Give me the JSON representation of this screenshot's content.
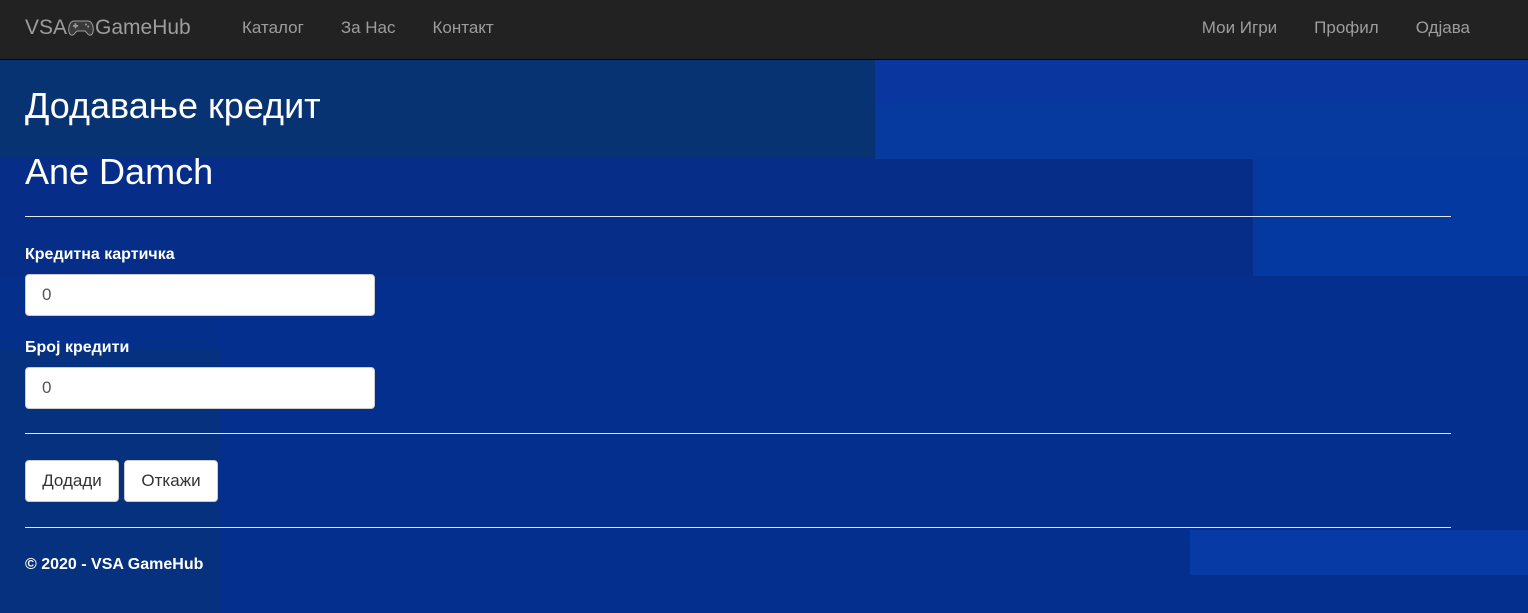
{
  "navbar": {
    "brand_prefix": "VSA",
    "brand_suffix": "GameHub",
    "brand_icon": "gamepad-icon",
    "left_links": [
      "Каталог",
      "За Нас",
      "Контакт"
    ],
    "right_links": [
      "Мои Игри",
      "Профил",
      "Одјава"
    ]
  },
  "page": {
    "title": "Додавање кредит",
    "user_name": "Ane Damch"
  },
  "form": {
    "card_label": "Кредитна картичка",
    "card_value": "0",
    "credits_label": "Број кредити",
    "credits_value": "0",
    "add_button": "Додади",
    "cancel_button": "Откажи"
  },
  "footer": {
    "text": "© 2020 - VSA GameHub"
  },
  "colors": {
    "navbar_bg": "#222222",
    "nav_text": "#9d9d9d",
    "background": "#04308c"
  }
}
